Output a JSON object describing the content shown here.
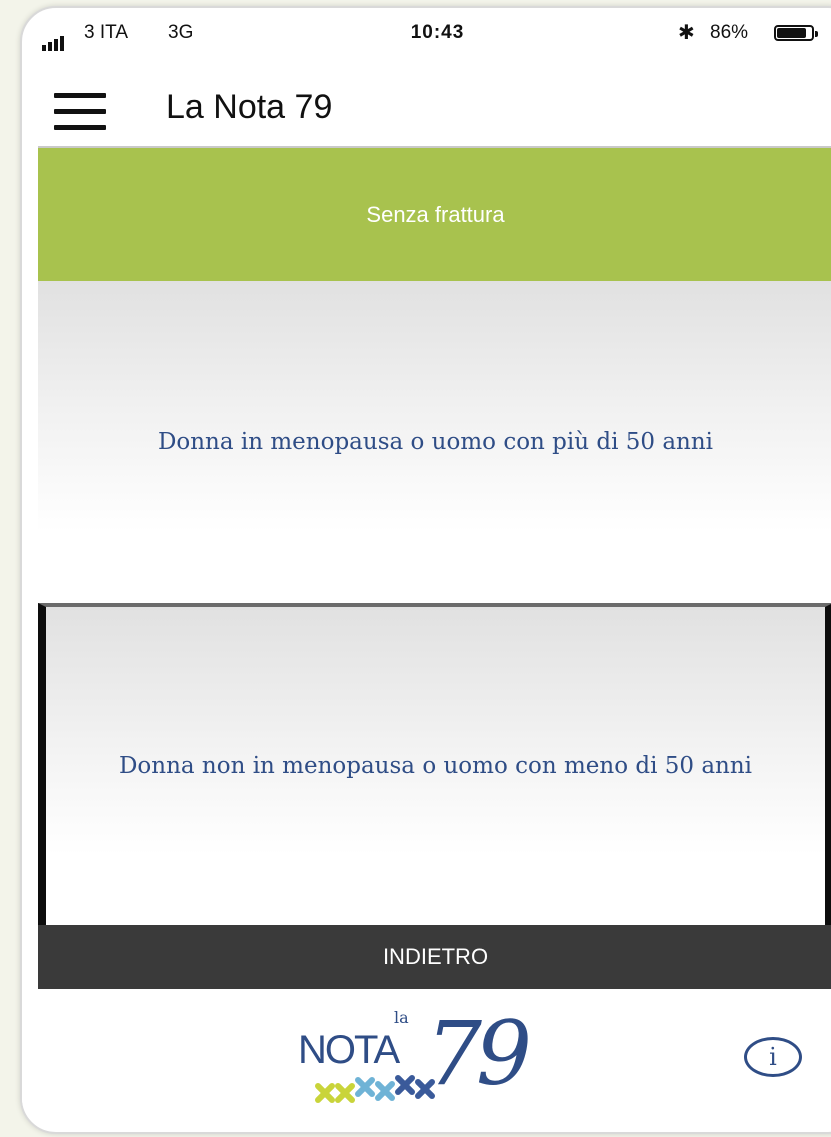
{
  "status_bar": {
    "carrier": "3 ITA",
    "network": "3G",
    "time": "10:43",
    "battery_pct": "86%",
    "battery_level": 0.86
  },
  "nav": {
    "title": "La Nota 79"
  },
  "section": {
    "header": "Senza frattura",
    "options": [
      "Donna in menopausa o uomo con più di 50 anni",
      "Donna non in menopausa o uomo con meno di 50 anni"
    ],
    "back_label": "INDIETRO"
  },
  "footer": {
    "logo_small": "la",
    "logo_word": "NOTA",
    "logo_number": "79",
    "info_label": "i"
  },
  "colors": {
    "header_green": "#a8c24e",
    "option_text_blue": "#2f4d86",
    "back_bar": "#3a3a3a"
  }
}
